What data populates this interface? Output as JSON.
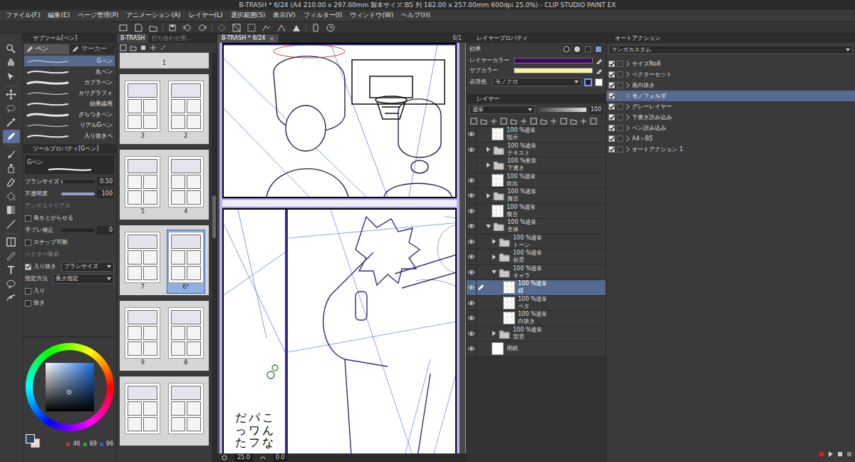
{
  "window": {
    "title": "B-TRASH * 6/24 (A4 210.00 x 297.00mm 製本サイズ:B5 判 182.00 x 257.00mm 600dpi 25.0%) - CLIP STUDIO PAINT EX"
  },
  "menu": [
    "ファイル(F)",
    "編集(E)",
    "ページ管理(P)",
    "アニメーション(A)",
    "レイヤー(L)",
    "選択範囲(S)",
    "表示(V)",
    "フィルター(I)",
    "ウィンドウ(W)",
    "ヘルプ(H)"
  ],
  "tools": [
    {
      "selected": false
    },
    {
      "selected": false
    },
    {
      "selected": false
    },
    {
      "selected": false
    },
    {
      "selected": false
    },
    {
      "selected": false
    },
    {
      "selected": true
    },
    {
      "selected": false
    },
    {
      "selected": false
    },
    {
      "selected": false
    },
    {
      "selected": false
    },
    {
      "selected": false
    },
    {
      "selected": false
    },
    {
      "selected": false
    },
    {
      "selected": false
    },
    {
      "selected": false
    },
    {
      "selected": false
    },
    {
      "selected": false
    }
  ],
  "subtool": {
    "title": "サブツール[ペン]",
    "tabs": [
      {
        "label": "ペン",
        "selected": true
      },
      {
        "label": "マーカー",
        "selected": false
      }
    ],
    "items": [
      {
        "label": "Gペン",
        "selected": true
      },
      {
        "label": "丸ペン",
        "selected": false
      },
      {
        "label": "カブラペン",
        "selected": false
      },
      {
        "label": "カリグラフィ",
        "selected": false
      },
      {
        "label": "効果線用",
        "selected": false
      },
      {
        "label": "ざらつきペン",
        "selected": false
      },
      {
        "label": "リアルGペン",
        "selected": false
      },
      {
        "label": "入り抜きペ",
        "selected": false
      }
    ]
  },
  "tool_property": {
    "title": "ツールプロパティ[Gペン]",
    "preset": "Gペン",
    "rows": [
      {
        "kind": "slider",
        "label": "ブラシサイズ",
        "value": "0.50",
        "level": 0.05
      },
      {
        "kind": "slider",
        "label": "不透明度",
        "value": "100",
        "level": 1
      },
      {
        "kind": "label",
        "label": "アンチエイリアス",
        "disabled": true
      },
      {
        "kind": "checkbox",
        "label": "角をとがらせる",
        "checked": false
      },
      {
        "kind": "slider",
        "label": "手ブレ補正",
        "value": "0",
        "level": 0
      },
      {
        "kind": "checkbox",
        "label": "スナップ可能",
        "checked": false
      },
      {
        "kind": "label",
        "label": "ベクター吸着",
        "disabled": true
      },
      {
        "kind": "select",
        "label": "入り抜き",
        "value": "ブラシサイズ",
        "checked": true
      },
      {
        "kind": "select",
        "label": "指定方法",
        "value": "長さ指定"
      },
      {
        "kind": "checkbox",
        "label": "入り",
        "checked": false
      },
      {
        "kind": "checkbox",
        "label": "抜き",
        "checked": false
      }
    ]
  },
  "color": {
    "swatches": [
      {
        "color": "#2e4560",
        "selected": true
      },
      {
        "color": "#f6d2d2",
        "selected": false
      }
    ],
    "rgb": [
      {
        "value": "46",
        "color": "#d03232"
      },
      {
        "value": "69",
        "color": "#2fa83a"
      },
      {
        "value": "96",
        "color": "#3558d8"
      }
    ]
  },
  "page_manager": {
    "tabs": [
      {
        "label": "B-TRASH",
        "selected": true
      },
      {
        "label": "打ち合わせ用…",
        "selected": false
      }
    ],
    "first_page": "1",
    "pages": [
      {
        "label": "3",
        "selected": false
      },
      {
        "label": "2",
        "selected": false
      },
      {
        "label": "5",
        "selected": false
      },
      {
        "label": "4",
        "selected": false
      },
      {
        "label": "7",
        "selected": false
      },
      {
        "label": "6*",
        "selected": true
      },
      {
        "label": "9",
        "selected": false
      },
      {
        "label": "8",
        "selected": false
      },
      {
        "label": "",
        "selected": false
      },
      {
        "label": "",
        "selected": false
      }
    ]
  },
  "canvas": {
    "tab": "B-TRASH * 6/24",
    "navigator_tab": "6/1",
    "balloon": [
      "こんな",
      "パワフ",
      "だった"
    ],
    "zoom": "25.0",
    "angle": "0.0"
  },
  "layer_property": {
    "title": "レイヤープロパティ",
    "effect": "効果",
    "layer_color_label": "レイヤーカラー",
    "layer_color": "#3c0a5a",
    "sub_color_label": "サブカラー",
    "sub_color": "#f8f2a8",
    "expression_label": "表現色",
    "expression": "モノクロ",
    "expression_swatches": [
      {
        "color": "#1c1c2c",
        "selected": true
      },
      {
        "color": "#ffffff",
        "selected": false
      }
    ]
  },
  "layers": {
    "title": "レイヤー",
    "blend": "通常",
    "opacity": "100",
    "items": [
      {
        "name": "指示",
        "mode": "100 %通常",
        "kind": "layer",
        "visible": true,
        "selected": false
      },
      {
        "name": "テキスト",
        "mode": "100 %通常",
        "kind": "folder",
        "expanded": false,
        "visible": true,
        "selected": false
      },
      {
        "name": "下書き",
        "mode": "100 %乗算",
        "kind": "folder",
        "expanded": false,
        "visible": false,
        "selected": false
      },
      {
        "name": "吹出",
        "mode": "100 %通常",
        "kind": "layer",
        "visible": true,
        "selected": false
      },
      {
        "name": "擬音",
        "mode": "100 %通常",
        "kind": "folder",
        "expanded": false,
        "visible": true,
        "selected": false
      },
      {
        "name": "擬音",
        "mode": "100 %通常",
        "kind": "layer",
        "visible": true,
        "selected": false
      },
      {
        "name": "全体",
        "mode": "100 %通常",
        "kind": "folder",
        "expanded": true,
        "visible": true,
        "selected": false,
        "children": [
          {
            "name": "トーン",
            "mode": "100 %通常",
            "kind": "folder",
            "expanded": false,
            "visible": true,
            "selected": false
          },
          {
            "name": "前景",
            "mode": "100 %通常",
            "kind": "folder",
            "expanded": false,
            "visible": true,
            "selected": false
          },
          {
            "name": "キャラ",
            "mode": "100 %通常",
            "kind": "folder",
            "expanded": true,
            "visible": true,
            "selected": false,
            "children": [
              {
                "name": "線",
                "mode": "100 %通常",
                "kind": "layer",
                "visible": true,
                "selected": true
              },
              {
                "name": "ベタ",
                "mode": "100 %通常",
                "kind": "layer",
                "visible": true,
                "selected": false
              },
              {
                "name": "白抜き",
                "mode": "100 %通常",
                "kind": "layer",
                "visible": true,
                "selected": false
              }
            ]
          },
          {
            "name": "背景",
            "mode": "100 %通常",
            "kind": "folder",
            "expanded": false,
            "visible": true,
            "selected": false
          }
        ]
      },
      {
        "name": "用紙",
        "kind": "paper",
        "visible": true,
        "selected": false
      }
    ]
  },
  "auto_action": {
    "title": "オートアクション",
    "set": "マンガカスタム",
    "items": [
      {
        "label": "サイズNo8",
        "checked": true,
        "selected": false
      },
      {
        "label": "ベクターセット",
        "checked": true,
        "selected": false
      },
      {
        "label": "黒白抜き",
        "checked": true,
        "selected": false
      },
      {
        "label": "モノフォルダ",
        "checked": true,
        "selected": true
      },
      {
        "label": "グレーレイヤー",
        "checked": true,
        "selected": false
      },
      {
        "label": "下書き読み込み",
        "checked": true,
        "selected": false
      },
      {
        "label": "ペン読み込み",
        "checked": true,
        "selected": false
      },
      {
        "label": "A4＞B5",
        "checked": true,
        "selected": false
      },
      {
        "label": "オートアクション 1",
        "checked": true,
        "selected": false
      }
    ]
  }
}
